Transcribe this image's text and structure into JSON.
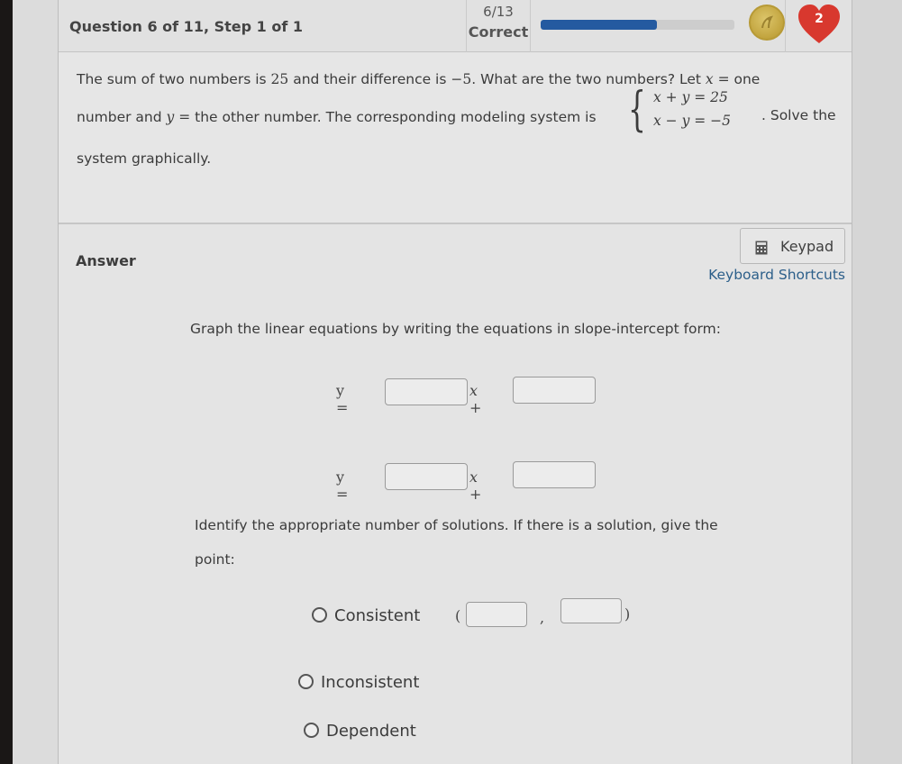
{
  "header": {
    "question_label": "Question 6 of 11, Step 1 of 1",
    "score_fraction": "6/13",
    "score_label": "Correct",
    "progress_fraction": 0.6,
    "lives_count": "2",
    "colors": {
      "progress": "#245aa0",
      "heart": "#d8382e",
      "coin": "#c9ad47"
    }
  },
  "question": {
    "line1_pre": "The sum of two numbers is ",
    "line1_sum": "25",
    "line1_mid": " and their difference is ",
    "line1_diff": "−5",
    "line1_post": ". What are the two numbers? Let ",
    "var_x": "x",
    "equals": " = ",
    "line1_end": " one",
    "line2_pre": "number and ",
    "var_y": "y",
    "line2_post": " the other number. The corresponding modeling system is",
    "system_eq1": "x + y = 25",
    "system_eq2": "x − y = −5",
    "line2_end": ". Solve the",
    "line3": "system graphically."
  },
  "answer": {
    "label": "Answer",
    "keypad_label": "Keypad",
    "shortcuts_label": "Keyboard Shortcuts",
    "instruction1": "Graph the linear equations by writing the equations in slope-intercept form:",
    "eq_prefix": "y =",
    "eq_mid": "x +",
    "equations": [
      {
        "slope": "",
        "intercept": ""
      },
      {
        "slope": "",
        "intercept": ""
      }
    ],
    "instruction2_line1": "Identify the appropriate number of solutions. If there is a solution, give the",
    "instruction2_line2": "point:",
    "options": [
      {
        "label": "Consistent",
        "selected": false
      },
      {
        "label": "Inconsistent",
        "selected": false
      },
      {
        "label": "Dependent",
        "selected": false
      }
    ],
    "point": {
      "open": "(",
      "sep": ",",
      "close": ")",
      "x": "",
      "y": ""
    }
  }
}
